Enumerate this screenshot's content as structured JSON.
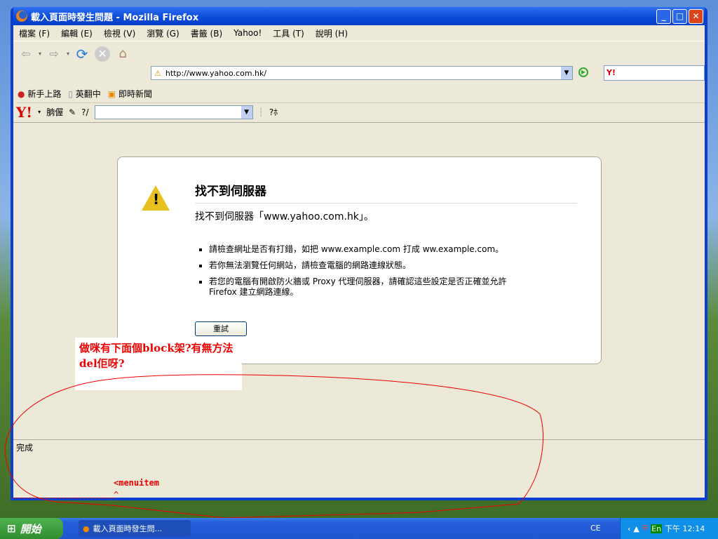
{
  "window": {
    "title": "載入頁面時發生問題 - Mozilla Firefox",
    "min": "_",
    "max": "□",
    "close": "✕"
  },
  "menu": [
    "檔案 (F)",
    "編輯 (E)",
    "檢視 (V)",
    "瀏覽 (G)",
    "書籤 (B)",
    "Yahoo!",
    "工具 (T)",
    "說明 (H)"
  ],
  "nav": {
    "url": "http://www.yahoo.com.hk/",
    "search_logo": "Y!"
  },
  "bookmarks": [
    "新手上路",
    "英翻中",
    "即時新聞"
  ],
  "yahoo_toolbar": {
    "logo": "Y!",
    "item1": "朒偓",
    "item2": "?/",
    "item3": "?ﾎ"
  },
  "error": {
    "title": "找不到伺服器",
    "message": "找不到伺服器「www.yahoo.com.hk」。",
    "bullets": [
      "請檢查網址是否有打錯，如把 www.example.com 打成 ww.example.com。",
      "若你無法瀏覽任何網站，請檢查電腦的網路連線狀態。",
      "若您的電腦有開啟防火牆或 Proxy 代理伺服器，請確認這些設定是否正確並允許 Firefox 建立網路連線。"
    ],
    "retry": "重試"
  },
  "annotation": {
    "note": "做咪有下面個block架?有無方法del佢呀?",
    "menuitem": "<menuitem",
    "caret": "^"
  },
  "status": "完成",
  "taskbar": {
    "start": "開始",
    "task": "載入頁面時發生問...",
    "lang": "CE",
    "ime": "En",
    "clock": "下午 12:14"
  }
}
